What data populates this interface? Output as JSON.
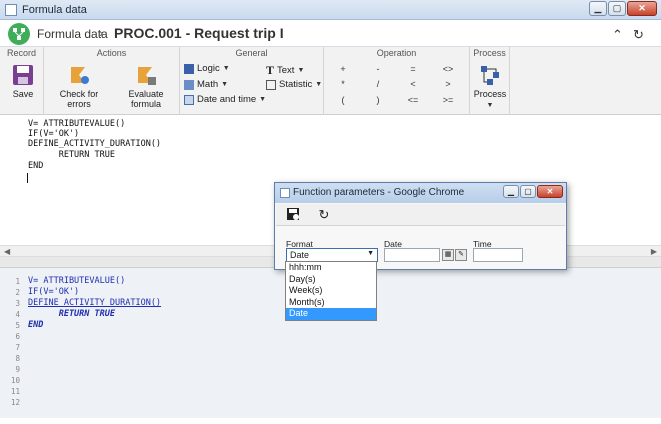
{
  "window": {
    "title": "Formula data"
  },
  "header": {
    "root": "Formula data",
    "separator": "›",
    "page_title": "PROC.001 - Request trip I"
  },
  "ribbon": {
    "groups": {
      "record": "Record",
      "actions": "Actions",
      "general": "General",
      "operation": "Operation",
      "process": "Process"
    },
    "save": "Save",
    "check_errors": "Check for errors",
    "evaluate": "Evaluate formula",
    "logic": "Logic",
    "math": "Math",
    "datetime": "Date and time",
    "text": "Text",
    "statistic": "Statistic",
    "process_btn": "Process",
    "operators": [
      "+",
      "-",
      "=",
      "<>",
      "*",
      "/",
      "<",
      ">",
      "(",
      ")",
      "<=",
      ">="
    ]
  },
  "editor": {
    "lines": [
      "V= ATTRIBUTEVALUE()",
      "IF(V='OK')",
      "DEFINE_ACTIVITY_DURATION()",
      "      RETURN TRUE",
      "END"
    ]
  },
  "preview": {
    "line_numbers": [
      "1",
      "2",
      "3",
      "4",
      "5",
      "6",
      "7",
      "8",
      "9",
      "10",
      "11",
      "12"
    ]
  },
  "popup": {
    "title": "Function parameters - Google Chrome",
    "format_label": "Format",
    "date_label": "Date",
    "time_label": "Time",
    "format_value": "Date",
    "format_options": [
      "hhh:mm",
      "Day(s)",
      "Week(s)",
      "Month(s)",
      "Date"
    ],
    "selected_option": "Date"
  },
  "colors": {
    "accent_green": "#3fae5a",
    "selection_blue": "#3399ff",
    "keyword_blue": "#1f2fb0"
  }
}
